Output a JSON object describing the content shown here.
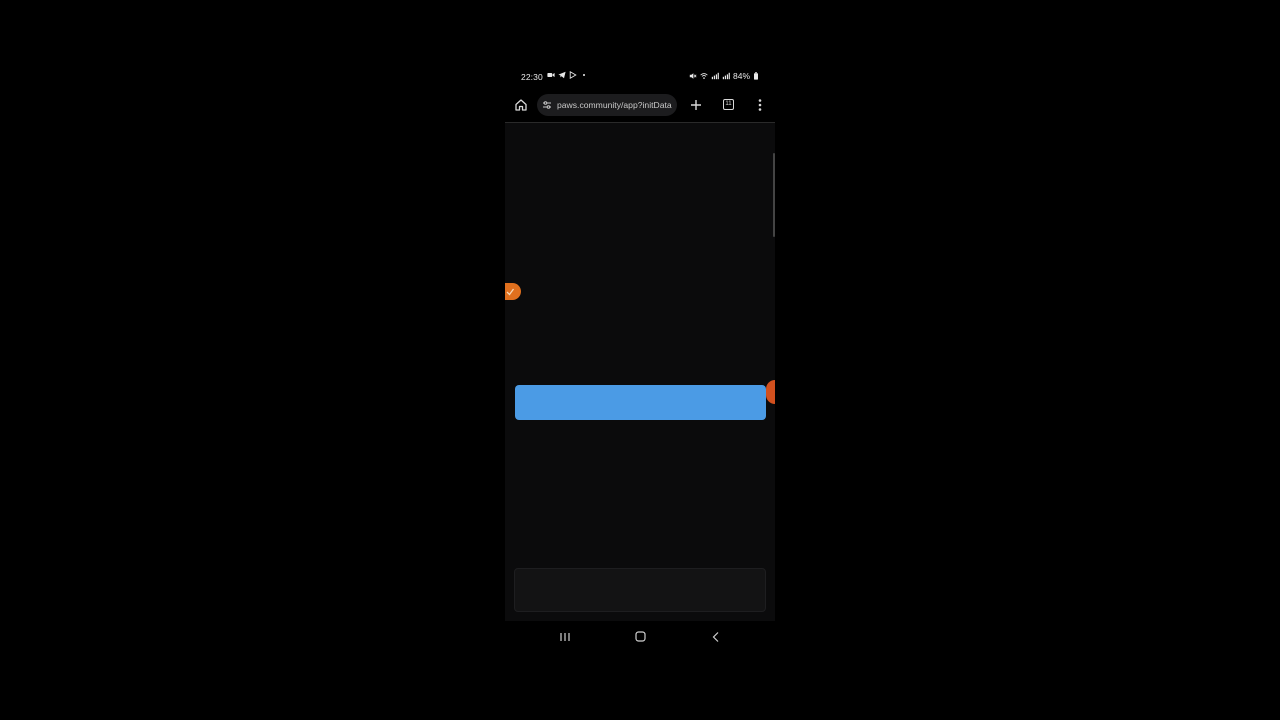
{
  "status_bar": {
    "time": "22:30",
    "battery": "84%",
    "left_icons": [
      "video-icon",
      "telegram-icon",
      "play-store-icon",
      "dot-icon"
    ],
    "right_icons": [
      "mute-icon",
      "wifi-icon",
      "signal-icon",
      "signal-icon",
      "battery-icon"
    ]
  },
  "browser": {
    "url": "paws.community/app?initData",
    "tab_count": "11",
    "icons": [
      "home-icon",
      "site-settings-icon",
      "plus-icon",
      "tabs-icon",
      "more-icon"
    ]
  },
  "page": {
    "primary_button_label": "",
    "colors": {
      "background": "#0b0b0c",
      "primary_button": "#4b9be5",
      "avatar_left": "#e0701e",
      "avatar_right": "#d2501e"
    }
  },
  "nav_bar": {
    "icons": [
      "recents-icon",
      "home-icon",
      "back-icon"
    ]
  }
}
